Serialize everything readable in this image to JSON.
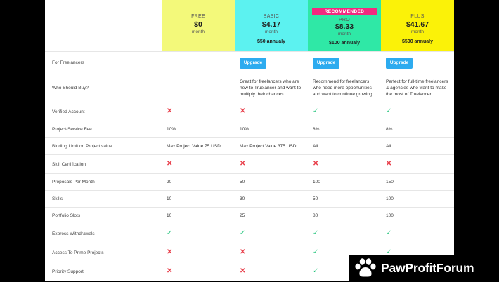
{
  "plans": [
    {
      "tier": "",
      "price": "",
      "per": "",
      "annual": "",
      "badge": ""
    },
    {
      "tier": "FREE",
      "price": "$0",
      "per": "month",
      "annual": "",
      "badge": ""
    },
    {
      "tier": "BASIC",
      "price": "$4.17",
      "per": "month",
      "annual": "$50 annualy",
      "badge": ""
    },
    {
      "tier": "PRO",
      "price": "$8.33",
      "per": "month",
      "annual": "$100 annualy",
      "badge": "RECOMMENDED"
    },
    {
      "tier": "PLUS",
      "price": "$41.67",
      "per": "month",
      "annual": "$500 annualy",
      "badge": ""
    }
  ],
  "header_colors": {
    "free": "#f3f97a",
    "basic": "#5cf2f0",
    "pro": "#2fe8a6",
    "plus": "#fbf208"
  },
  "upgrade_row": {
    "label": "For Freelancers",
    "button": "Upgrade"
  },
  "rows": {
    "who": {
      "label": "Who Should Buy?",
      "free": "-",
      "basic": "Great for freelancers who are new to Truelancer and want to multiply their chances",
      "pro": "Recommend for freelancers who need more opportunities and want to continue growing",
      "plus": "Perfect for full-time freelancers & agencies who want to make the most of Truelancer"
    },
    "verified": {
      "label": "Verified Account",
      "free": "x",
      "basic": "x",
      "pro": "check",
      "plus": "check"
    },
    "fee": {
      "label": "Project/Service Fee",
      "free": "10%",
      "basic": "10%",
      "pro": "8%",
      "plus": "8%"
    },
    "bid": {
      "label": "Bidding Limit on Project value",
      "free": "Max Project Value 75 USD",
      "basic": "Max Project Value 375 USD",
      "pro": "All",
      "plus": "All"
    },
    "skillcert": {
      "label": "Skill Certification",
      "free": "x",
      "basic": "x",
      "pro": "x",
      "plus": "x"
    },
    "proposals": {
      "label": "Proposals Per Month",
      "free": "20",
      "basic": "50",
      "pro": "100",
      "plus": "150"
    },
    "skills": {
      "label": "Skills",
      "free": "10",
      "basic": "30",
      "pro": "50",
      "plus": "100"
    },
    "portfolio": {
      "label": "Portfolio Slots",
      "free": "10",
      "basic": "25",
      "pro": "80",
      "plus": "100"
    },
    "withdraw": {
      "label": "Express Withdrawals",
      "free": "check",
      "basic": "check",
      "pro": "check",
      "plus": "check"
    },
    "prime": {
      "label": "Access To Prime Projects",
      "free": "x",
      "basic": "x",
      "pro": "check",
      "plus": "check"
    },
    "support": {
      "label": "Priority Support",
      "free": "x",
      "basic": "x",
      "pro": "check",
      "plus": "check"
    }
  },
  "glyphs": {
    "x": "✕",
    "check": "✓"
  },
  "watermark": {
    "text": "PawProfitForum",
    "icon": "paw-icon"
  }
}
